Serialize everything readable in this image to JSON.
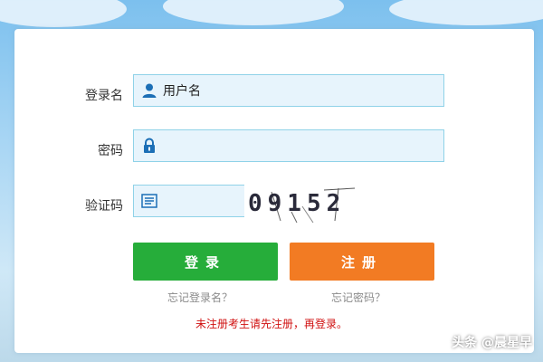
{
  "login": {
    "username_label": "登录名",
    "username_value": "用户名",
    "password_label": "密码",
    "password_value": "",
    "captcha_label": "验证码",
    "captcha_value": "",
    "captcha_image_text": "09152",
    "login_button": "登录",
    "register_button": "注册",
    "forgot_username": "忘记登录名？",
    "forgot_password": "忘记密码？",
    "notice": "未注册考生请先注册，再登录。"
  },
  "colors": {
    "login_button": "#26ad3a",
    "register_button": "#f27b23",
    "field_border": "#8fd2e8",
    "notice": "#d01010"
  },
  "icons": {
    "username": "user-icon",
    "password": "lock-icon",
    "captcha": "captcha-icon"
  },
  "watermark": "头条 @晨星早"
}
